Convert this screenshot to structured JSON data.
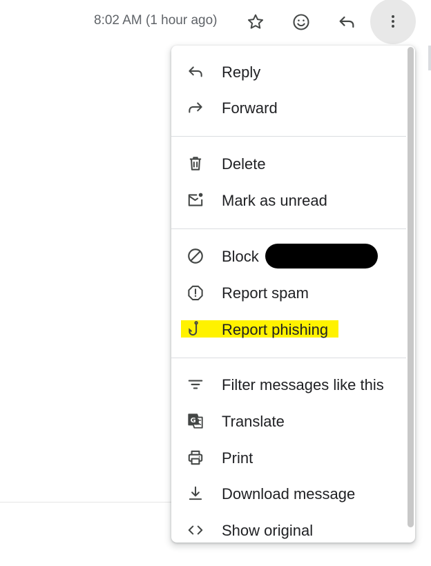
{
  "header": {
    "timestamp": "8:02 AM (1 hour ago)",
    "actions": [
      {
        "icon": "star-icon"
      },
      {
        "icon": "emoji-icon"
      },
      {
        "icon": "reply-icon"
      },
      {
        "icon": "more-vert-icon"
      }
    ]
  },
  "menu": {
    "highlight_color": "#fff200",
    "items": [
      {
        "label": "Reply",
        "icon": "reply-icon"
      },
      {
        "label": "Forward",
        "icon": "forward-icon"
      },
      {
        "label": "Delete",
        "icon": "trash-icon"
      },
      {
        "label": "Mark as unread",
        "icon": "mark-unread-icon"
      },
      {
        "label": "Block",
        "icon": "block-icon"
      },
      {
        "label": "Report spam",
        "icon": "report-spam-icon"
      },
      {
        "label": "Report phishing",
        "icon": "phishing-hook-icon"
      },
      {
        "label": "Filter messages like this",
        "icon": "filter-icon"
      },
      {
        "label": "Translate",
        "icon": "translate-icon"
      },
      {
        "label": "Print",
        "icon": "print-icon"
      },
      {
        "label": "Download message",
        "icon": "download-icon"
      },
      {
        "label": "Show original",
        "icon": "code-icon"
      }
    ]
  }
}
